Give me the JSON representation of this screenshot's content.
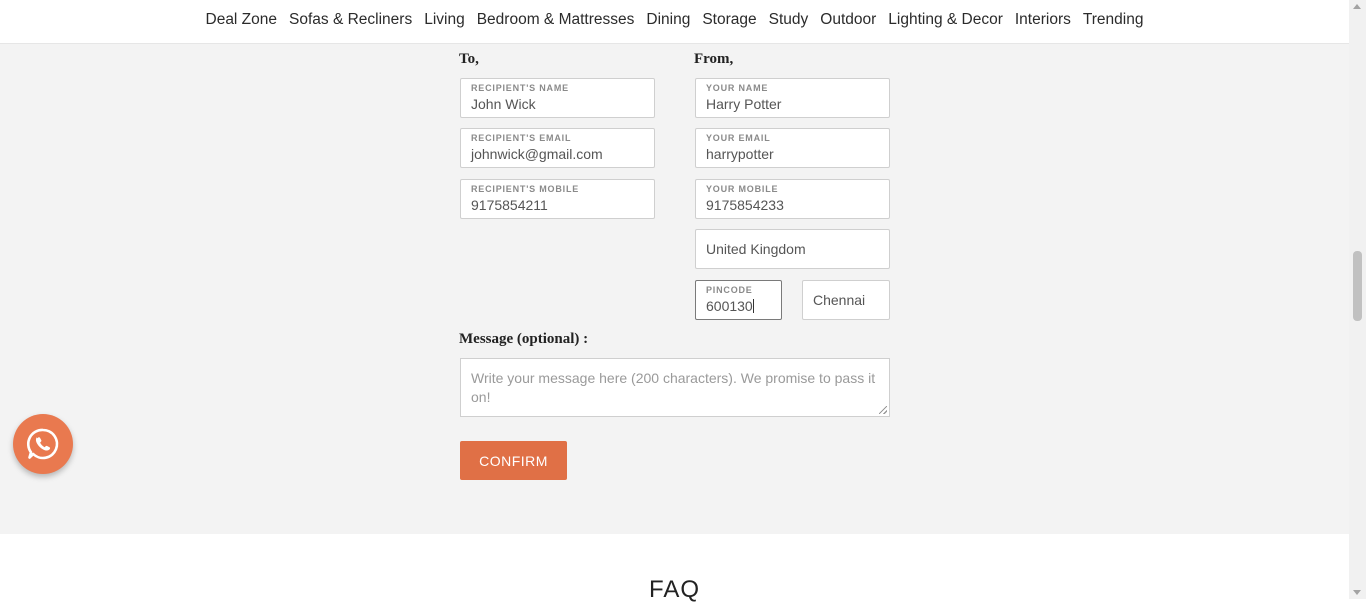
{
  "nav": {
    "items": [
      "Deal Zone",
      "Sofas & Recliners",
      "Living",
      "Bedroom & Mattresses",
      "Dining",
      "Storage",
      "Study",
      "Outdoor",
      "Lighting & Decor",
      "Interiors",
      "Trending"
    ]
  },
  "form": {
    "to_title": "To,",
    "from_title": "From,",
    "recipient_name": {
      "label": "RECIPIENT'S NAME",
      "value": "John Wick"
    },
    "recipient_email": {
      "label": "RECIPIENT'S EMAIL",
      "value": "johnwick@gmail.com"
    },
    "recipient_mobile": {
      "label": "RECIPIENT'S MOBILE",
      "value": "9175854211"
    },
    "your_name": {
      "label": "YOUR NAME",
      "value": "Harry Potter"
    },
    "your_email": {
      "label": "YOUR EMAIL",
      "value": "harrypotter"
    },
    "your_mobile": {
      "label": "YOUR MOBILE",
      "value": "9175854233"
    },
    "country": {
      "value": "United Kingdom"
    },
    "pincode": {
      "label": "PINCODE",
      "value": "600130"
    },
    "city": {
      "value": "Chennai"
    },
    "message_label": "Message (optional) :",
    "message_placeholder": "Write your message here (200 characters). We promise to pass it on!",
    "confirm_label": "CONFIRM"
  },
  "faq": {
    "title": "FAQ"
  },
  "colors": {
    "accent": "#e07046",
    "background": "#f3f3f3",
    "whatsapp": "#e9794f"
  },
  "icons": {
    "whatsapp": "whatsapp-icon"
  }
}
